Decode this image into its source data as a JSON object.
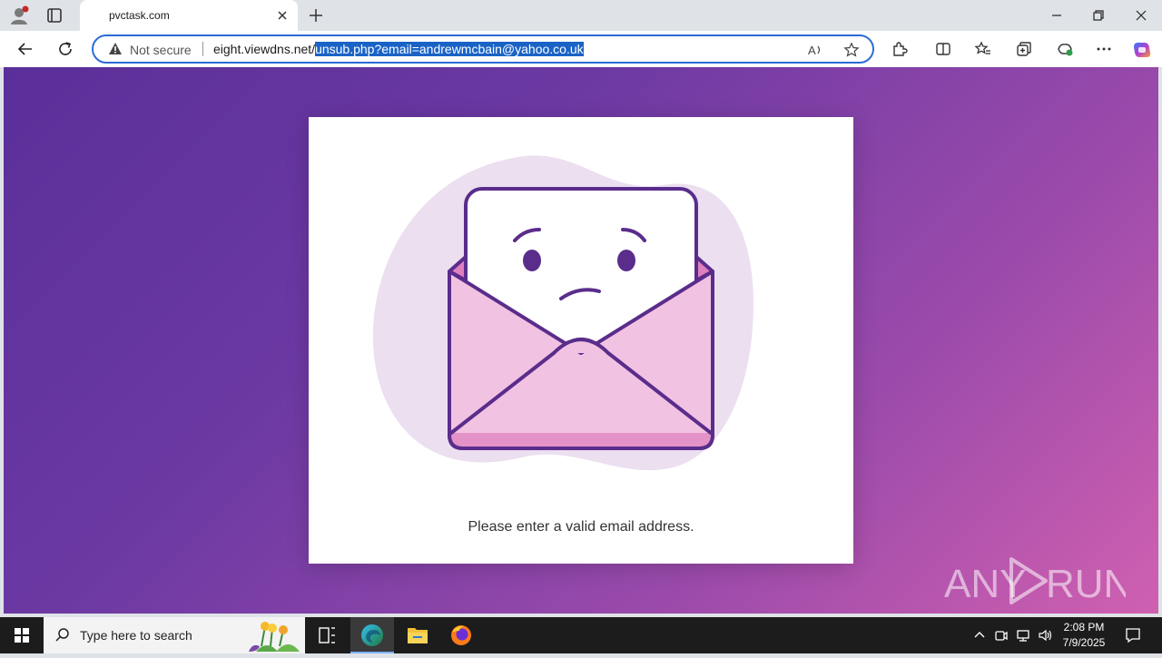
{
  "browser": {
    "tab": {
      "title": "pvctask.com"
    },
    "address_bar": {
      "security_label": "Not secure",
      "url_host": "eight.viewdns.net/",
      "url_path_selected": "unsub.php?email=andrewmcbain@yahoo.co.uk"
    },
    "icons": {
      "profile": "profile-icon",
      "back": "back-arrow-icon",
      "refresh": "refresh-icon",
      "read_aloud": "read-aloud-icon",
      "favorite": "star-icon",
      "extensions": "puzzle-icon",
      "split": "split-screen-icon",
      "favorites": "favorites-icon",
      "collections": "collections-icon",
      "copilot": "copilot-icon",
      "more": "more-icon"
    },
    "accent_color": "#2c6bd6",
    "selection_color": "#1a63c6"
  },
  "page": {
    "message": "Please enter a valid email address.",
    "illustration": "sad-envelope-icon",
    "gradient": [
      "#5a2f99",
      "#d060b0"
    ]
  },
  "watermark": {
    "text_left": "ANY",
    "text_right": "RUN"
  },
  "taskbar": {
    "search_placeholder": "Type here to search",
    "clock_time": "2:08 PM",
    "clock_date": "7/9/2025"
  }
}
